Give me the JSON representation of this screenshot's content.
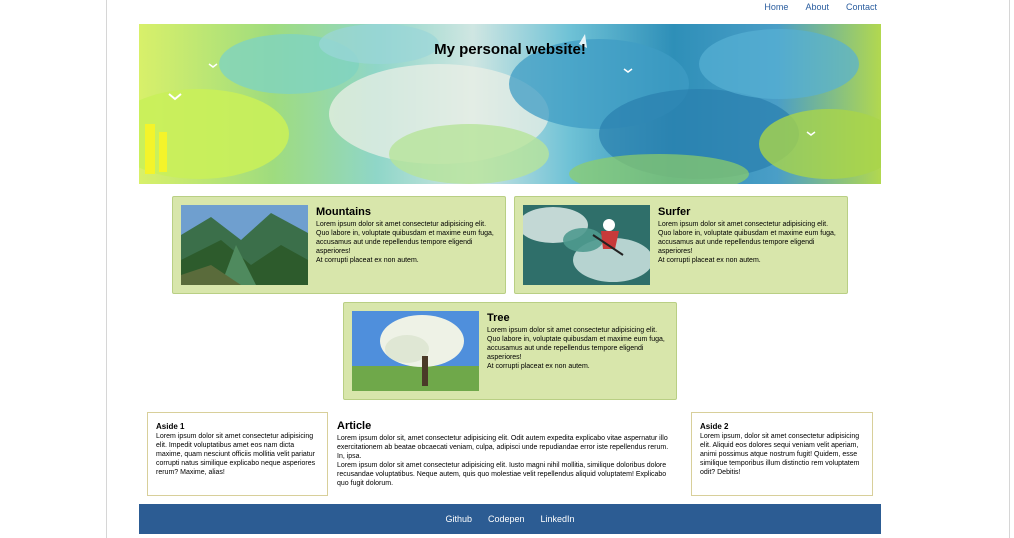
{
  "nav": {
    "items": [
      {
        "label": "Home"
      },
      {
        "label": "About"
      },
      {
        "label": "Contact"
      }
    ]
  },
  "hero": {
    "title": "My personal website!"
  },
  "cards": [
    {
      "title": "Mountains",
      "text1": "Lorem ipsum dolor sit amet consectetur adipisicing elit. Quo labore in, voluptate quibusdam et maxime eum fuga, accusamus aut unde repellendus tempore eligendi asperiores!",
      "text2": "At corrupti placeat ex non autem."
    },
    {
      "title": "Surfer",
      "text1": "Lorem ipsum dolor sit amet consectetur adipisicing elit. Quo labore in, voluptate quibusdam et maxime eum fuga, accusamus aut unde repellendus tempore eligendi asperiores!",
      "text2": "At corrupti placeat ex non autem."
    },
    {
      "title": "Tree",
      "text1": "Lorem ipsum dolor sit amet consectetur adipisicing elit. Quo labore in, voluptate quibusdam et maxime eum fuga, accusamus aut unde repellendus tempore eligendi asperiores!",
      "text2": "At corrupti placeat ex non autem."
    }
  ],
  "aside1": {
    "title": "Aside 1",
    "text": "Lorem ipsum dolor sit amet consectetur adipisicing elit. Impedit voluptatibus amet eos nam dicta maxime, quam nesciunt officiis mollitia velit pariatur corrupti natus similique explicabo neque asperiores rerum? Maxime, alias!"
  },
  "article": {
    "title": "Article",
    "para1": "Lorem ipsum dolor sit, amet consectetur adipisicing elit. Odit autem expedita explicabo vitae aspernatur illo exercitationem ab beatae obcaecati veniam, culpa, adipisci unde repudiandae error iste repellendus rerum. In, ipsa.",
    "para2": "Lorem ipsum dolor sit amet consectetur adipisicing elit. Iusto magni nihil mollitia, similique doloribus dolore recusandae voluptatibus. Neque autem, quis quo molestiae velit repellendus aliquid voluptatem! Explicabo quo fugit dolorum."
  },
  "aside2": {
    "title": "Aside 2",
    "text": "Lorem ipsum, dolor sit amet consectetur adipisicing elit. Aliquid eos dolores sequi veniam velit aperiam, animi possimus atque nostrum fugit! Quidem, esse similique temporibus illum distinctio rem voluptatem odit? Debitis!"
  },
  "footer": {
    "links": [
      {
        "label": "Github"
      },
      {
        "label": "Codepen"
      },
      {
        "label": "LinkedIn"
      }
    ]
  },
  "colors": {
    "card_bg": "#d8e6ab",
    "footer_bg": "#2c5c93",
    "nav_link": "#2a5d9f"
  }
}
